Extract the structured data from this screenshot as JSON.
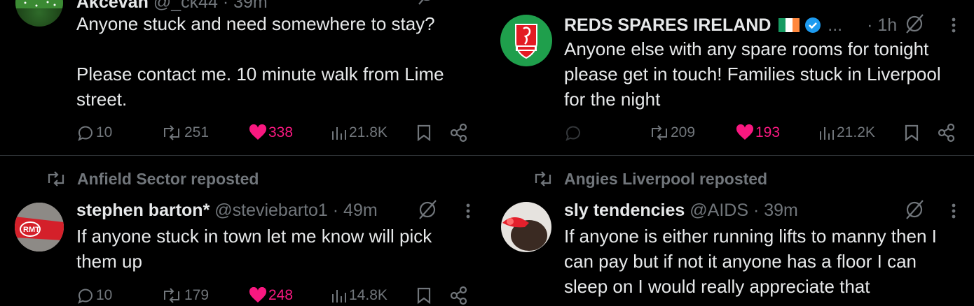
{
  "colors": {
    "background": "#000000",
    "text": "#e7e9ea",
    "muted": "#71767b",
    "like": "#f91880",
    "verified": "#1d9bf0",
    "divider": "#2f3336"
  },
  "tweets": [
    {
      "name": "Akcevan",
      "handle": "@_ck44 · 39m",
      "text_lines": [
        "Anyone stuck and  need somewhere to stay?",
        "",
        "Please contact me. 10 minute walk from Lime",
        "street."
      ],
      "replies": "10",
      "reposts": "251",
      "likes": "338",
      "views": "21.8K",
      "liked": true
    },
    {
      "name": "REDS SPARES IRELAND",
      "flag": "🇮🇪",
      "ellipsis": "...",
      "time": "· 1h",
      "text_lines": [
        "Anyone else with any spare rooms for tonight",
        "please get in touch! Families stuck in Liverpool",
        "for the night"
      ],
      "replies": "",
      "reposts": "209",
      "likes": "193",
      "views": "21.2K",
      "liked": true
    },
    {
      "repost_by": "Anfield Sector reposted",
      "name": "stephen barton*",
      "handle": "@steviebarto1 · 49m",
      "text_lines": [
        "If anyone stuck in town let me know will pick",
        "them up"
      ],
      "replies": "10",
      "reposts": "179",
      "likes": "248",
      "views": "14.8K",
      "liked": true
    },
    {
      "repost_by": "Angies Liverpool reposted",
      "name": "sly tendencies",
      "handle": "@AIDS · 39m",
      "text_lines": [
        "If anyone is either running lifts to manny then I",
        "can pay but if not it anyone has a floor I can",
        "sleep on I would really appreciate that"
      ]
    }
  ]
}
